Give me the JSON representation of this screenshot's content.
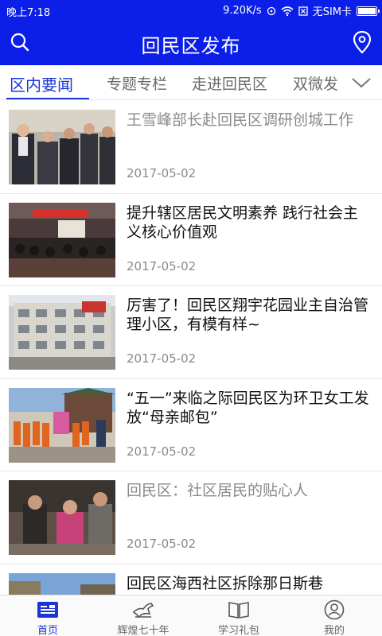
{
  "status_bar": {
    "time": "晚上7:18",
    "speed": "9.20K/s",
    "sim": "无SIM卡",
    "battery_level": 0.9
  },
  "header": {
    "title": "回民区发布"
  },
  "tabs": [
    {
      "label": "区内要闻",
      "active": true
    },
    {
      "label": "专题专栏",
      "active": false
    },
    {
      "label": "走进回民区",
      "active": false
    },
    {
      "label": "双微发",
      "active": false
    }
  ],
  "news": [
    {
      "headline": "王雪峰部长赴回民区调研创城工作",
      "date": "2017-05-02",
      "read": true
    },
    {
      "headline": "提升辖区居民文明素养 践行社会主义核心价值观",
      "date": "2017-05-02",
      "read": false
    },
    {
      "headline": "厉害了！回民区翔宇花园业主自治管理小区，有模有样~",
      "date": "2017-05-02",
      "read": false
    },
    {
      "headline": "“五一”来临之际回民区为环卫女工发放“母亲邮包”",
      "date": "2017-05-02",
      "read": false
    },
    {
      "headline": "回民区：社区居民的贴心人",
      "date": "2017-05-02",
      "read": true
    },
    {
      "headline": "回民区海西社区拆除那日斯巷",
      "date": "",
      "read": false
    }
  ],
  "bottom_nav": [
    {
      "label": "首页",
      "icon": "news-icon",
      "active": true
    },
    {
      "label": "辉煌七十年",
      "icon": "horse-icon",
      "active": false
    },
    {
      "label": "学习礼包",
      "icon": "book-icon",
      "active": false
    },
    {
      "label": "我的",
      "icon": "user-icon",
      "active": false
    }
  ],
  "colors": {
    "primary": "#0b1fe8",
    "accent": "#1a35d6"
  }
}
